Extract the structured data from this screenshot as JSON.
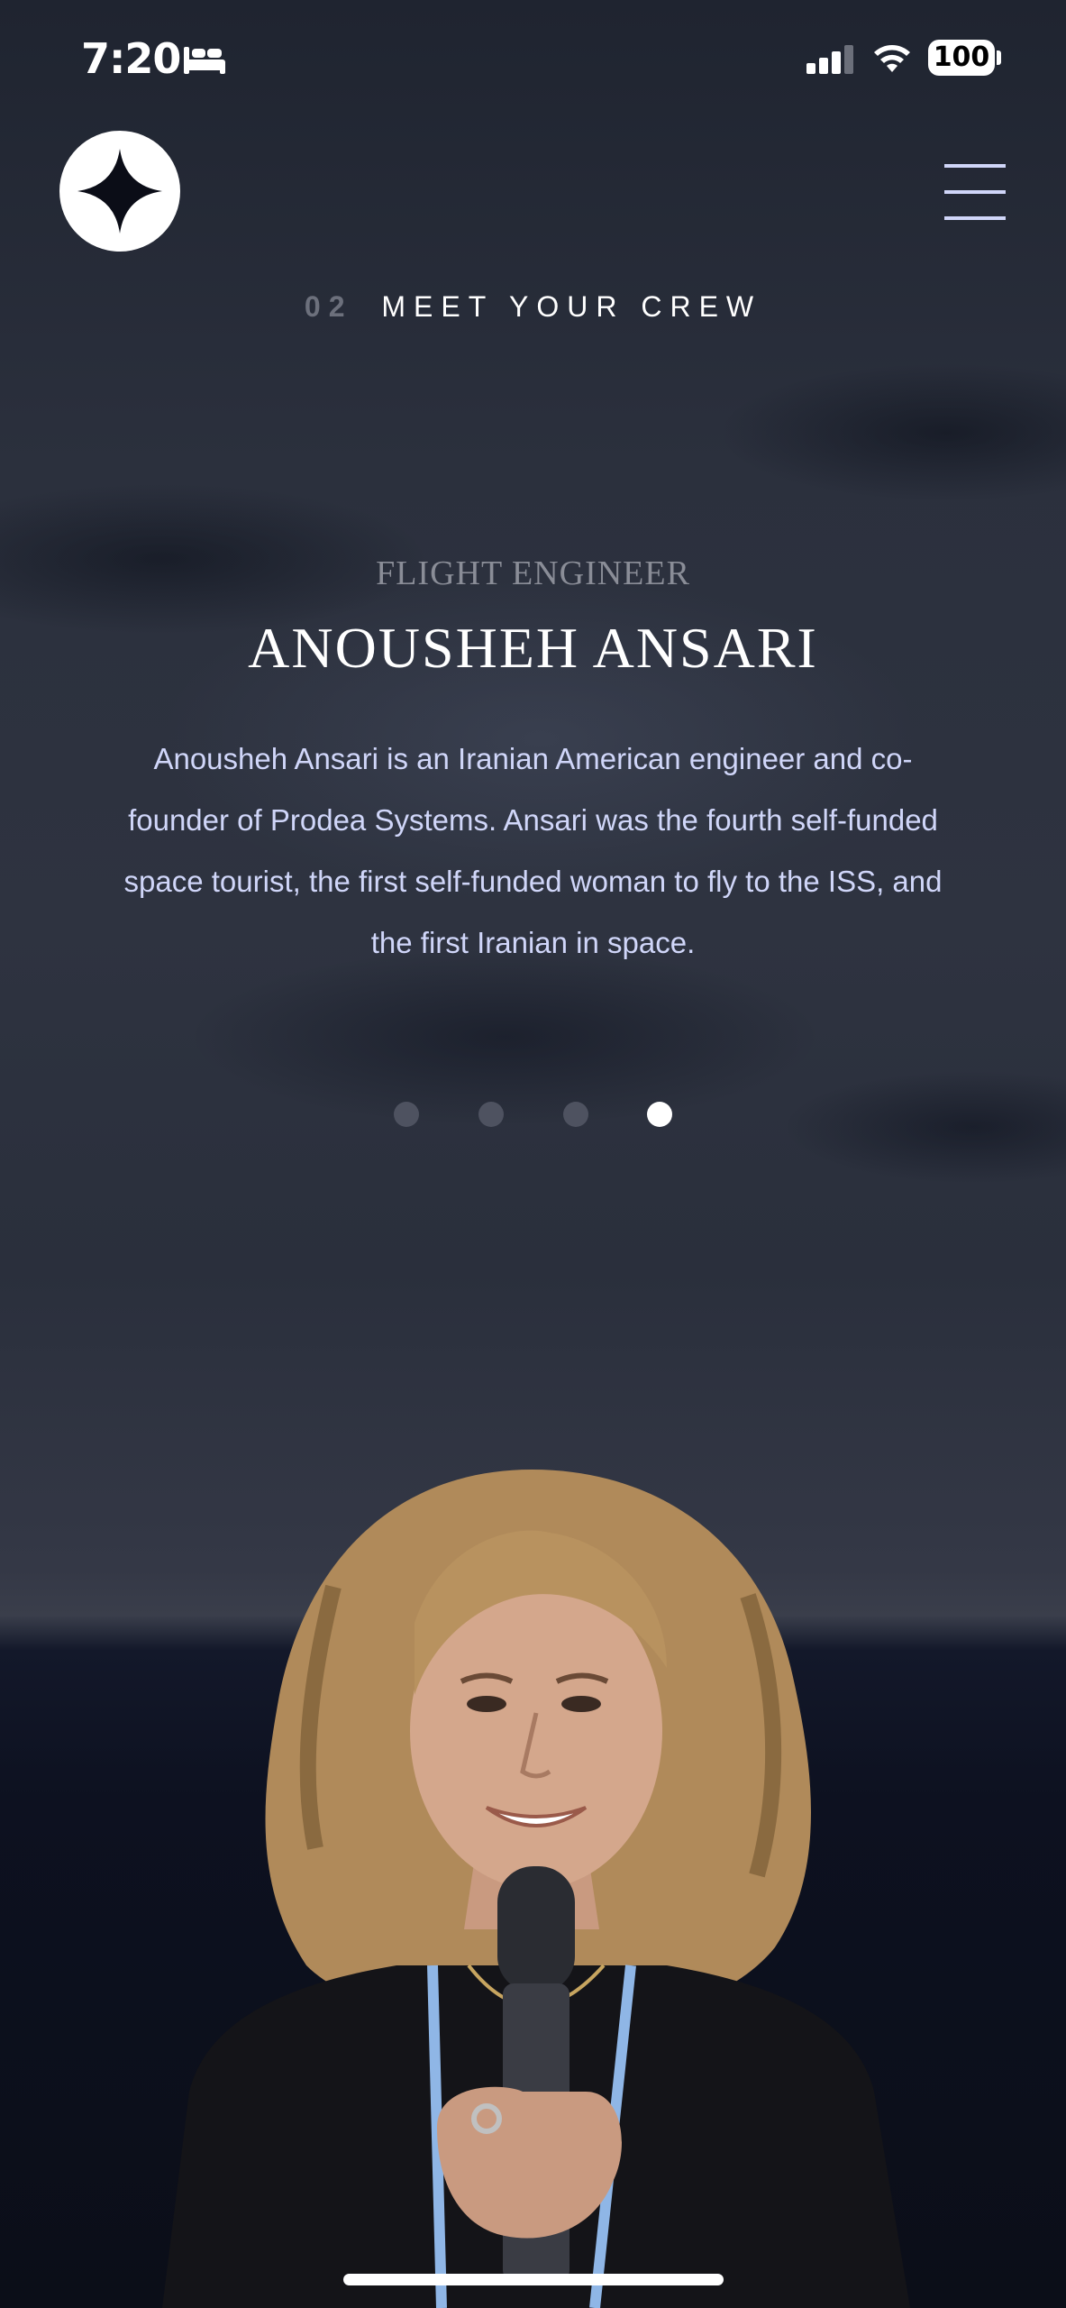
{
  "status_bar": {
    "time": "7:20",
    "battery": "100",
    "icons": [
      "bed-icon",
      "signal-icon",
      "wifi-icon",
      "battery-icon"
    ]
  },
  "header": {
    "logo_icon": "four-point-star-logo",
    "menu_icon": "hamburger-menu-icon"
  },
  "page": {
    "number": "02",
    "title": "MEET YOUR CREW"
  },
  "crew": {
    "role": "FLIGHT ENGINEER",
    "name": "ANOUSHEH ANSARI",
    "bio": "Anousheh Ansari is an Iranian American engineer and co-founder of Prodea Systems. Ansari was the fourth self-funded space tourist, the first self-funded woman to fly to the ISS, and the first Iranian in space."
  },
  "carousel": {
    "total": 4,
    "active_index": 3
  },
  "colors": {
    "accent": "#d0d6f9",
    "dot_inactive": "#4e5260",
    "dot_active": "#ffffff"
  }
}
